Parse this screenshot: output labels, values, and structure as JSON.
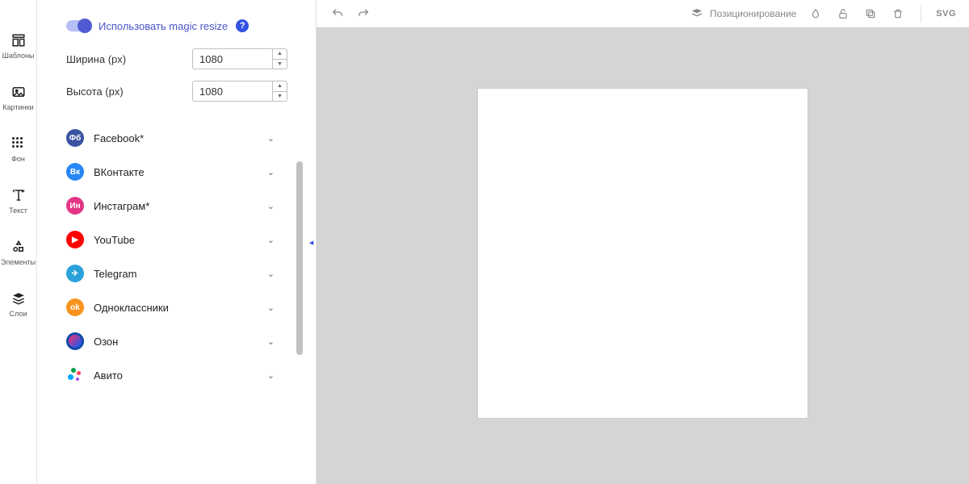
{
  "rail": {
    "items": [
      {
        "label": "Шаблоны"
      },
      {
        "label": "Картинки"
      },
      {
        "label": "Фон"
      },
      {
        "label": "Текст"
      },
      {
        "label": "Элементы"
      },
      {
        "label": "Слои"
      }
    ]
  },
  "magic_resize": {
    "toggle_label": "Использовать magic resize",
    "width_label": "Ширина (px)",
    "height_label": "Высота (px)",
    "width_value": "1080",
    "height_value": "1080"
  },
  "presets": [
    {
      "name": "Facebook*",
      "icon_bg": "#3a54a3",
      "icon_text": "Фб"
    },
    {
      "name": "ВКонтакте",
      "icon_bg": "#2787f5",
      "icon_text": "Вк"
    },
    {
      "name": "Инстаграм*",
      "icon_bg": "#e33585",
      "icon_text": "Ин"
    },
    {
      "name": "YouTube",
      "icon_bg": "#ff0000",
      "icon_text": "▶"
    },
    {
      "name": "Telegram",
      "icon_bg": "#2aa1da",
      "icon_text": "✈"
    },
    {
      "name": "Одноклассники",
      "icon_bg": "#f7931e",
      "icon_text": "ok"
    },
    {
      "name": "Озон",
      "icon_bg": "#0d4aa8",
      "icon_text": "o"
    },
    {
      "name": "Авито",
      "icon_bg": "",
      "icon_text": ""
    }
  ],
  "topbar": {
    "positioning": "Позиционирование",
    "svg": "SVG"
  }
}
